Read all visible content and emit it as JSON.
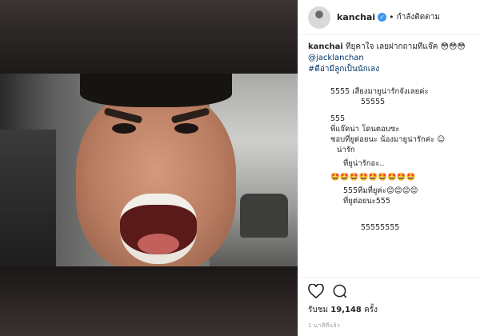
{
  "post": {
    "username": "kanchai",
    "separator": "•",
    "follow_status": "กำลังติดตาม",
    "caption": {
      "user": "kanchai",
      "text": "ที่ยุคาใจ เลยฝากถามที่แจ๊ค 😳😳😳",
      "mention": "@jacklanchan",
      "hashtag": "#ดีอ่ามีลูกเป็นนักเลง"
    },
    "replies": [
      "5555 เสียงมายูน่ารักจังเลยค่ะ",
      "55555",
      "555",
      "พี่แจ๊คน่า โดนตอบซะ",
      "ชอบที่ยูต่อยนะ น้องมายูน่ารักค่ะ ☺",
      "น่ารัก",
      "ที่ยูน่ารักอะ..",
      "🤩🤩🤩🤩🤩🤩🤩🤩🤩",
      "555ทีมที่ยูค่ะ😊😊😊😊",
      "ที่ยูต่อยนะ555",
      "55555555"
    ],
    "views_label": "รับชม",
    "views_count": "19,148",
    "views_suffix": "ครั้ง",
    "timestamp": "1 นาทีที่แล้ว"
  },
  "icons": {
    "like": "heart-icon",
    "comment": "speech-bubble-icon",
    "verified": "verified-badge-icon"
  },
  "colors": {
    "link": "#003569",
    "verified": "#3897f0",
    "muted": "#999999"
  }
}
